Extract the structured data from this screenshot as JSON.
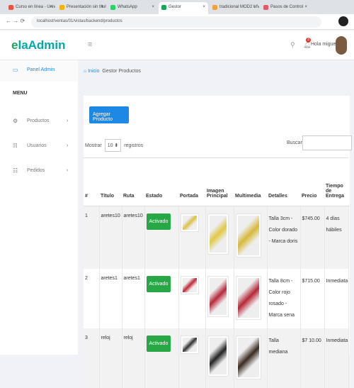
{
  "browser": {
    "tabs": [
      {
        "label": "Curso en línea - Univ",
        "color": "#e8543f"
      },
      {
        "label": "Presentación sin título",
        "color": "#f4b400"
      },
      {
        "label": "WhatsApp",
        "color": "#25d366"
      },
      {
        "label": "Gestor",
        "color": "#1aa55e",
        "active": true
      },
      {
        "label": "tradicional MOD2 LIV",
        "color": "#f4a13a"
      },
      {
        "label": "Pasos de Control",
        "color": "#e05a6a"
      }
    ],
    "url": "localhost/ventas/01/vistas/backend/productos"
  },
  "header": {
    "logo_prefix": "e",
    "logo_text": "laAdmin",
    "user": "Hola miguel",
    "notification_count": "3"
  },
  "sidebar": {
    "panel": "Panel Admin",
    "menu_title": "MENU",
    "items": [
      {
        "label": "Productos",
        "icon": "gears"
      },
      {
        "label": "Usuarios",
        "icon": "users"
      },
      {
        "label": "Pedidos",
        "icon": "list"
      }
    ]
  },
  "breadcrumb": {
    "home": "Inicio",
    "current": "Gestor Productos"
  },
  "main": {
    "add_button": "Agregar Producto",
    "show_label": "Mostrar",
    "show_value": "10",
    "records_label": "registros",
    "search_label": "Buscar:",
    "search_value": ""
  },
  "table": {
    "headers": [
      "#",
      "Título",
      "Ruta",
      "Estado",
      "Portada",
      "Imagen Principal",
      "Multimedia",
      "Detalles",
      "Precio",
      "Tiempo de Entrega"
    ],
    "rows": [
      {
        "num": "1",
        "titulo": "aretes10",
        "ruta": "aretes10",
        "estado": "Activado",
        "detalles": "Talla 3cm - Color dorado - Marca doris",
        "precio": "$745.00",
        "tiempo": "4 días hábiles",
        "img": [
          "#d9c24a",
          "#e0c845",
          "#d8b83a"
        ]
      },
      {
        "num": "2",
        "titulo": "aretes1",
        "ruta": "aretes1",
        "estado": "Activado",
        "detalles": "Talla 8cm - Color rojo rosado - Marca sena",
        "precio": "$715.00",
        "tiempo": "Inmediata",
        "img": [
          "#c0283a",
          "#b8283a",
          "#b52636"
        ]
      },
      {
        "num": "3",
        "titulo": "reloj",
        "ruta": "reloj",
        "estado": "Activado",
        "detalles": "Talla mediana",
        "precio": "$7 10.00",
        "tiempo": "Inmediata",
        "img": [
          "#333333",
          "#222222",
          "#3a2a20"
        ]
      }
    ]
  }
}
